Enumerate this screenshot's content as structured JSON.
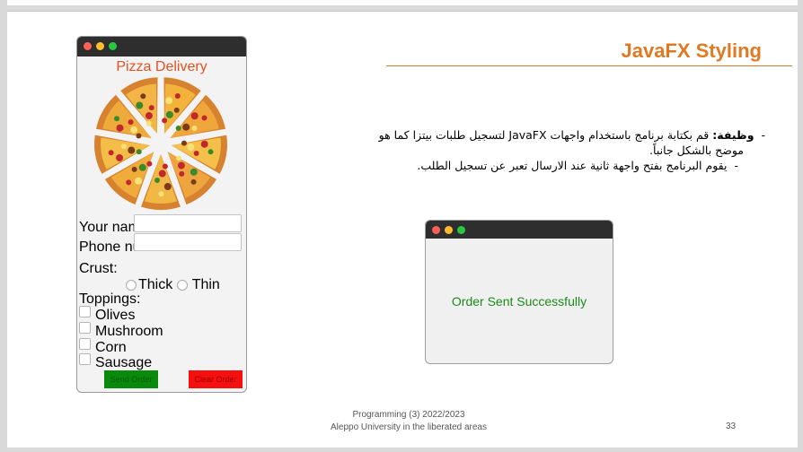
{
  "slide": {
    "title": "JavaFX Styling",
    "bullet1_label": "وظيفة:",
    "bullet1_text": "قم بكتابة برنامج باستخدام واجهات JavaFX لتسجيل طلبات بيتزا كما هو",
    "bullet1_cont": "موضح بالشكل جانباً.",
    "bullet2_text": "يقوم البرنامج بفتح واجهة ثانية عند الارسال تعبر عن تسجيل الطلب.",
    "footer_line1": "Programming (3) 2022/2023",
    "footer_line2": "Aleppo University in the liberated areas",
    "page_number": "33"
  },
  "pizza_window": {
    "title": "Pizza Delivery",
    "name_label": "Your name:",
    "phone_label": "Phone number:",
    "name_value": "",
    "phone_value": "",
    "crust_label": "Crust:",
    "crust_options": [
      "Thick",
      "Thin"
    ],
    "toppings_label": "Toppings:",
    "toppings": [
      "Olives",
      "Mushroom",
      "Corn",
      "Sausage"
    ],
    "send_button": "Send Order",
    "clear_button": "Clear Order"
  },
  "confirm_window": {
    "message": "Order Sent Successfully"
  },
  "colors": {
    "accent": "#e07a22",
    "pizza_title": "#e3521f",
    "send": "#0a8a0a",
    "clear": "#f50f0f",
    "success_text": "#1c8a1c"
  }
}
